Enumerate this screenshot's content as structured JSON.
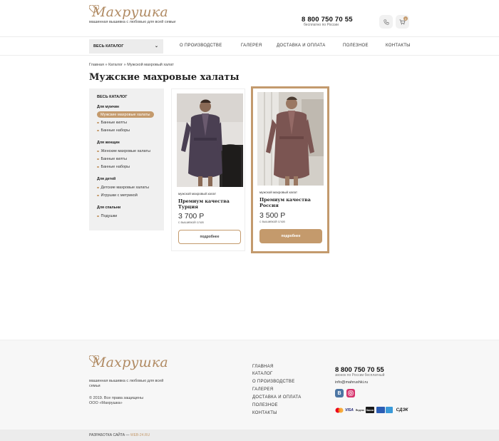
{
  "header": {
    "logo_text": "Махрушка",
    "tagline": "машинная вышивка с любовью для всей семьи",
    "phone": "8 800 750 70 55",
    "phone_note": "бесплатно по России",
    "cart_count": "0"
  },
  "nav": {
    "catalog_button": "ВЕСЬ КАТАЛОГ",
    "items": [
      "О ПРОИЗВОДСТВЕ",
      "ГАЛЕРЕЯ",
      "ДОСТАВКА И ОПЛАТА",
      "ПОЛЕЗНОЕ",
      "КОНТАКТЫ"
    ]
  },
  "breadcrumb": {
    "home": "Главная",
    "sep": "»",
    "catalog": "Каталог",
    "current": "Мужской махровый халат"
  },
  "page_title": "Мужские махровые халаты",
  "sidebar": {
    "all": "ВЕСЬ КАТАЛОГ",
    "groups": [
      {
        "title": "Для мужчин",
        "items": [
          "Мужские махровые халаты",
          "Банные килты",
          "Банные наборы"
        ]
      },
      {
        "title": "Для женщин",
        "items": [
          "Женские махровые халаты",
          "Банные килты",
          "Банные наборы"
        ]
      },
      {
        "title": "Для детей",
        "items": [
          "Детские махровые халаты",
          "Игрушки с метрикой"
        ]
      },
      {
        "title": "Для спальни",
        "items": [
          "Подушки"
        ]
      }
    ]
  },
  "products": [
    {
      "type": "мужской махровый халат",
      "name": "Премиум качества Турция",
      "price": "3 700 Р",
      "note": "с вышивкой слов",
      "button": "подробнее"
    },
    {
      "type": "мужской махровый халат",
      "name": "Премиум качества Россия",
      "price": "3 500 Р",
      "note": "с вышивкой слов",
      "button": "подробнее"
    }
  ],
  "footer": {
    "logo_text": "Махрушка",
    "tagline": "машинная вышивка с любовью для всей семьи",
    "copyright_1": "© 2019. Все права защищены",
    "copyright_2": "ООО «Махрушка»",
    "menu": [
      "ГЛАВНАЯ",
      "КАТАЛОГ",
      "О ПРОИЗВОДСТВЕ",
      "ГАЛЕРЕЯ",
      "ДОСТАВКА И ОПЛАТА",
      "ПОЛЕЗНОЕ",
      "КОНТАКТЫ"
    ],
    "phone": "8 800 750 70 55",
    "phone_note": "звонок по России бесплатный",
    "email": "info@mahrushki.ru",
    "social": [
      "B"
    ],
    "payments": [
      "VISA",
      "Яндекс",
      "Касса",
      "СДЭК"
    ]
  },
  "bottom": {
    "dev_label": "РАЗРАБОТКА САЙТА —",
    "dev_link": "WEB-24.RU"
  },
  "colors": {
    "accent": "#c49a6c",
    "sidebar_bg": "#f0f0f0",
    "footer_bg": "#f7f7f7"
  }
}
